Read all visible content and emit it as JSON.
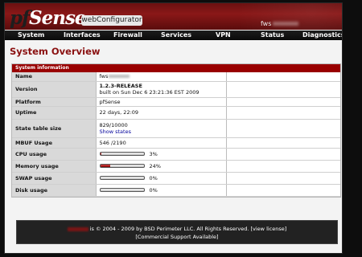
{
  "header": {
    "logo_text_pf": "pf",
    "logo_text_sense": "Sense",
    "badge": "webConfigurator",
    "hostname_prefix": "fws"
  },
  "nav": {
    "items": [
      "System",
      "Interfaces",
      "Firewall",
      "Services",
      "VPN",
      "Status",
      "Diagnostics"
    ]
  },
  "page_title": "System Overview",
  "panel": {
    "title": "System information",
    "rows": {
      "name": {
        "label": "Name",
        "value": "fws"
      },
      "version": {
        "label": "Version",
        "value": "1.2.3-RELEASE",
        "built": "built on Sun Dec 6 23:21:36 EST 2009"
      },
      "platform": {
        "label": "Platform",
        "value": "pfSense"
      },
      "uptime": {
        "label": "Uptime",
        "value": "22 days, 22:09"
      },
      "state": {
        "label": "State table size",
        "value": "829/10000",
        "link": "Show states"
      },
      "mbuf": {
        "label": "MBUF Usage",
        "value": "546 /2190"
      },
      "cpu": {
        "label": "CPU usage",
        "percent": 3,
        "text": "3%"
      },
      "memory": {
        "label": "Memory usage",
        "percent": 24,
        "text": "24%"
      },
      "swap": {
        "label": "SWAP usage",
        "percent": 0,
        "text": "0%"
      },
      "disk": {
        "label": "Disk usage",
        "percent": 0,
        "text": "0%"
      }
    }
  },
  "footer": {
    "line1": "is © 2004 - 2009 by BSD Perimeter LLC. All Rights Reserved. [view license]",
    "line2": "[Commercial Support Available]"
  },
  "colors": {
    "accent": "#990000",
    "title": "#8a1010",
    "link": "#00009a"
  }
}
